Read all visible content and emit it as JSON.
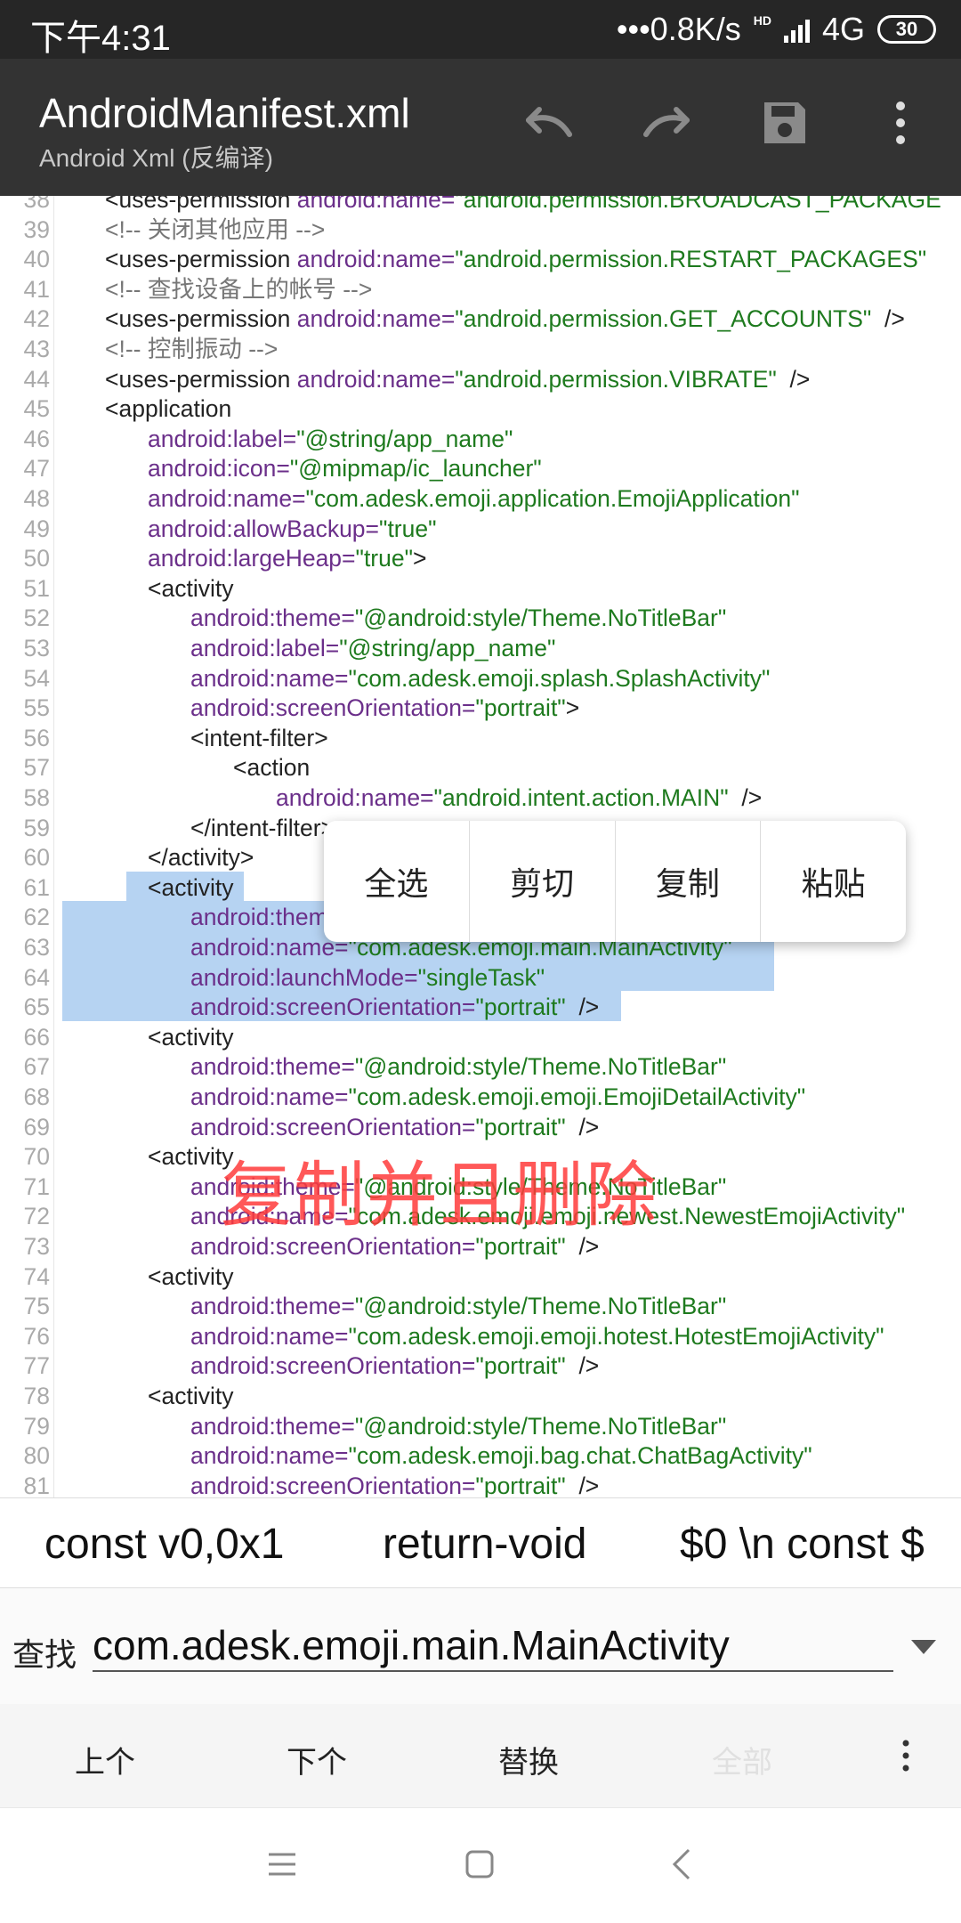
{
  "status_bar": {
    "time": "下午4:31",
    "speed": "•••0.8K/s",
    "hd": "HD",
    "network": "4G",
    "battery": "30"
  },
  "app_bar": {
    "title": "AndroidManifest.xml",
    "subtitle": "Android Xml (反编译)"
  },
  "code_lines": [
    {
      "n": "38",
      "i": 0,
      "s": [
        [
          "t",
          "<uses-permission "
        ],
        [
          "a",
          "android:name="
        ],
        [
          "v",
          "\"android.permission.BROADCAST_PACKAGE"
        ]
      ]
    },
    {
      "n": "39",
      "i": 0,
      "s": [
        [
          "c",
          "<!-- 关闭其他应用 -->"
        ]
      ]
    },
    {
      "n": "40",
      "i": 0,
      "s": [
        [
          "t",
          "<uses-permission "
        ],
        [
          "a",
          "android:name="
        ],
        [
          "v",
          "\"android.permission.RESTART_PACKAGES\""
        ]
      ]
    },
    {
      "n": "41",
      "i": 0,
      "s": [
        [
          "c",
          "<!-- 查找设备上的帐号 -->"
        ]
      ]
    },
    {
      "n": "42",
      "i": 0,
      "s": [
        [
          "t",
          "<uses-permission "
        ],
        [
          "a",
          "android:name="
        ],
        [
          "v",
          "\"android.permission.GET_ACCOUNTS\""
        ],
        [
          "t",
          "  />"
        ]
      ]
    },
    {
      "n": "43",
      "i": 0,
      "s": [
        [
          "c",
          "<!-- 控制振动 -->"
        ]
      ]
    },
    {
      "n": "44",
      "i": 0,
      "s": [
        [
          "t",
          "<uses-permission "
        ],
        [
          "a",
          "android:name="
        ],
        [
          "v",
          "\"android.permission.VIBRATE\""
        ],
        [
          "t",
          "  />"
        ]
      ]
    },
    {
      "n": "45",
      "i": 0,
      "s": [
        [
          "t",
          "<application"
        ]
      ]
    },
    {
      "n": "46",
      "i": 1,
      "s": [
        [
          "a",
          "android:label="
        ],
        [
          "v",
          "\"@string/app_name\""
        ]
      ]
    },
    {
      "n": "47",
      "i": 1,
      "s": [
        [
          "a",
          "android:icon="
        ],
        [
          "v",
          "\"@mipmap/ic_launcher\""
        ]
      ]
    },
    {
      "n": "48",
      "i": 1,
      "s": [
        [
          "a",
          "android:name="
        ],
        [
          "v",
          "\"com.adesk.emoji.application.EmojiApplication\""
        ]
      ]
    },
    {
      "n": "49",
      "i": 1,
      "s": [
        [
          "a",
          "android:allowBackup="
        ],
        [
          "v",
          "\"true\""
        ]
      ]
    },
    {
      "n": "50",
      "i": 1,
      "s": [
        [
          "a",
          "android:largeHeap="
        ],
        [
          "v",
          "\"true\""
        ],
        [
          "t",
          ">"
        ]
      ]
    },
    {
      "n": "51",
      "i": 1,
      "s": [
        [
          "t",
          "<activity"
        ]
      ]
    },
    {
      "n": "52",
      "i": 2,
      "s": [
        [
          "a",
          "android:theme="
        ],
        [
          "v",
          "\"@android:style/Theme.NoTitleBar\""
        ]
      ]
    },
    {
      "n": "53",
      "i": 2,
      "s": [
        [
          "a",
          "android:label="
        ],
        [
          "v",
          "\"@string/app_name\""
        ]
      ]
    },
    {
      "n": "54",
      "i": 2,
      "s": [
        [
          "a",
          "android:name="
        ],
        [
          "v",
          "\"com.adesk.emoji.splash.SplashActivity\""
        ]
      ]
    },
    {
      "n": "55",
      "i": 2,
      "s": [
        [
          "a",
          "android:screenOrientation="
        ],
        [
          "v",
          "\"portrait\""
        ],
        [
          "t",
          ">"
        ]
      ]
    },
    {
      "n": "56",
      "i": 2,
      "s": [
        [
          "t",
          "<intent-filter>"
        ]
      ]
    },
    {
      "n": "57",
      "i": 3,
      "s": [
        [
          "t",
          "<action"
        ]
      ]
    },
    {
      "n": "58",
      "i": 4,
      "s": [
        [
          "a",
          "android:name="
        ],
        [
          "v",
          "\"android.intent.action.MAIN\""
        ],
        [
          "t",
          "  />"
        ]
      ]
    },
    {
      "n": "59",
      "i": 2,
      "s": [
        [
          "t",
          "</intent-filter>"
        ]
      ]
    },
    {
      "n": "60",
      "i": 1,
      "s": [
        [
          "t",
          "</activity>"
        ]
      ]
    },
    {
      "n": "61",
      "i": 1,
      "s": [
        [
          "t",
          "<activity"
        ]
      ]
    },
    {
      "n": "62",
      "i": 2,
      "s": [
        [
          "a",
          "android:theme="
        ],
        [
          "v",
          "\"@android:style/Theme.NoTitleBar\""
        ]
      ]
    },
    {
      "n": "63",
      "i": 2,
      "s": [
        [
          "a",
          "android:name="
        ],
        [
          "v",
          "\"com.adesk.emoji.main.MainActivity\""
        ]
      ]
    },
    {
      "n": "64",
      "i": 2,
      "s": [
        [
          "a",
          "android:launchMode="
        ],
        [
          "v",
          "\"singleTask\""
        ]
      ]
    },
    {
      "n": "65",
      "i": 2,
      "s": [
        [
          "a",
          "android:screenOrientation="
        ],
        [
          "v",
          "\"portrait\""
        ],
        [
          "t",
          "  />"
        ]
      ]
    },
    {
      "n": "66",
      "i": 1,
      "s": [
        [
          "t",
          "<activity"
        ]
      ]
    },
    {
      "n": "67",
      "i": 2,
      "s": [
        [
          "a",
          "android:theme="
        ],
        [
          "v",
          "\"@android:style/Theme.NoTitleBar\""
        ]
      ]
    },
    {
      "n": "68",
      "i": 2,
      "s": [
        [
          "a",
          "android:name="
        ],
        [
          "v",
          "\"com.adesk.emoji.emoji.EmojiDetailActivity\""
        ]
      ]
    },
    {
      "n": "69",
      "i": 2,
      "s": [
        [
          "a",
          "android:screenOrientation="
        ],
        [
          "v",
          "\"portrait\""
        ],
        [
          "t",
          "  />"
        ]
      ]
    },
    {
      "n": "70",
      "i": 1,
      "s": [
        [
          "t",
          "<activity"
        ]
      ]
    },
    {
      "n": "71",
      "i": 2,
      "s": [
        [
          "a",
          "android:theme="
        ],
        [
          "v",
          "\"@android:style/Theme.NoTitleBar\""
        ]
      ]
    },
    {
      "n": "72",
      "i": 2,
      "s": [
        [
          "a",
          "android:name="
        ],
        [
          "v",
          "\"com.adesk.emoji.emoji.newest.NewestEmojiActivity\""
        ]
      ]
    },
    {
      "n": "73",
      "i": 2,
      "s": [
        [
          "a",
          "android:screenOrientation="
        ],
        [
          "v",
          "\"portrait\""
        ],
        [
          "t",
          "  />"
        ]
      ]
    },
    {
      "n": "74",
      "i": 1,
      "s": [
        [
          "t",
          "<activity"
        ]
      ]
    },
    {
      "n": "75",
      "i": 2,
      "s": [
        [
          "a",
          "android:theme="
        ],
        [
          "v",
          "\"@android:style/Theme.NoTitleBar\""
        ]
      ]
    },
    {
      "n": "76",
      "i": 2,
      "s": [
        [
          "a",
          "android:name="
        ],
        [
          "v",
          "\"com.adesk.emoji.emoji.hotest.HotestEmojiActivity\""
        ]
      ]
    },
    {
      "n": "77",
      "i": 2,
      "s": [
        [
          "a",
          "android:screenOrientation="
        ],
        [
          "v",
          "\"portrait\""
        ],
        [
          "t",
          "  />"
        ]
      ]
    },
    {
      "n": "78",
      "i": 1,
      "s": [
        [
          "t",
          "<activity"
        ]
      ]
    },
    {
      "n": "79",
      "i": 2,
      "s": [
        [
          "a",
          "android:theme="
        ],
        [
          "v",
          "\"@android:style/Theme.NoTitleBar\""
        ]
      ]
    },
    {
      "n": "80",
      "i": 2,
      "s": [
        [
          "a",
          "android:name="
        ],
        [
          "v",
          "\"com.adesk.emoji.bag.chat.ChatBagActivity\""
        ]
      ]
    },
    {
      "n": "81",
      "i": 2,
      "s": [
        [
          "a",
          "android:screenOrientation="
        ],
        [
          "v",
          "\"portrait\""
        ],
        [
          "t",
          "  />"
        ]
      ]
    }
  ],
  "context_menu": {
    "select_all": "全选",
    "cut": "剪切",
    "copy": "复制",
    "paste": "粘贴"
  },
  "overlay_text": "复制并且删除",
  "snippets": [
    "const v0,0x1",
    "return-void",
    "$0 \\n const $"
  ],
  "find": {
    "label": "查找",
    "value": "com.adesk.emoji.main.MainActivity"
  },
  "actions": {
    "prev": "上个",
    "next": "下个",
    "replace": "替换",
    "all": "全部"
  },
  "colors": {
    "tag": "#222222",
    "attr": "#6b2f8a",
    "value": "#1e7a1e",
    "comment": "#777777",
    "selection": "#b6d3f2",
    "app_bar": "#333333",
    "overlay": "#ff3b3b"
  }
}
